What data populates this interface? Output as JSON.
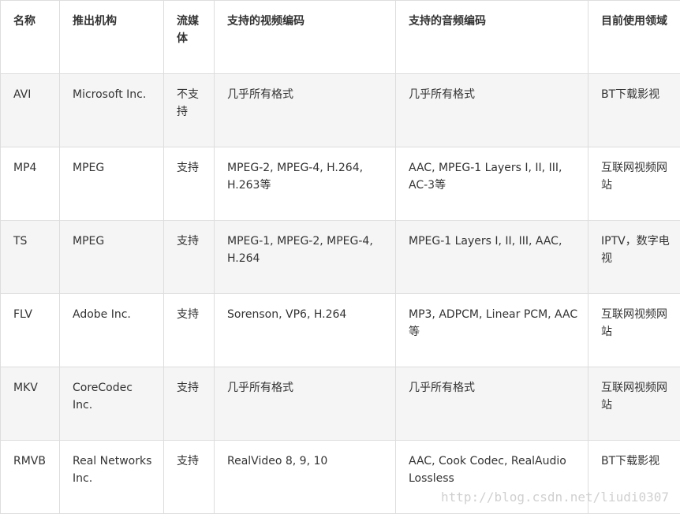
{
  "table": {
    "headers": [
      "名称",
      "推出机构",
      "流媒体",
      "支持的视频编码",
      "支持的音频编码",
      "目前使用领域"
    ],
    "rows": [
      [
        "AVI",
        "Microsoft Inc.",
        "不支持",
        "几乎所有格式",
        "几乎所有格式",
        "BT下载影视"
      ],
      [
        "MP4",
        "MPEG",
        "支持",
        "MPEG-2, MPEG-4, H.264, H.263等",
        "AAC, MPEG-1 Layers I, II, III, AC-3等",
        "互联网视频网站"
      ],
      [
        "TS",
        "MPEG",
        "支持",
        "MPEG-1, MPEG-2, MPEG-4, H.264",
        "MPEG-1 Layers I, II, III, AAC,",
        "IPTV，数字电视"
      ],
      [
        "FLV",
        "Adobe Inc.",
        "支持",
        "Sorenson, VP6, H.264",
        "MP3, ADPCM, Linear PCM, AAC等",
        "互联网视频网站"
      ],
      [
        "MKV",
        "CoreCodec Inc.",
        "支持",
        "几乎所有格式",
        "几乎所有格式",
        "互联网视频网站"
      ],
      [
        "RMVB",
        "Real Networks Inc.",
        "支持",
        "RealVideo 8, 9, 10",
        "AAC, Cook Codec, RealAudio Lossless",
        "BT下载影视"
      ]
    ]
  },
  "watermark": "http://blog.csdn.net/liudi0307"
}
